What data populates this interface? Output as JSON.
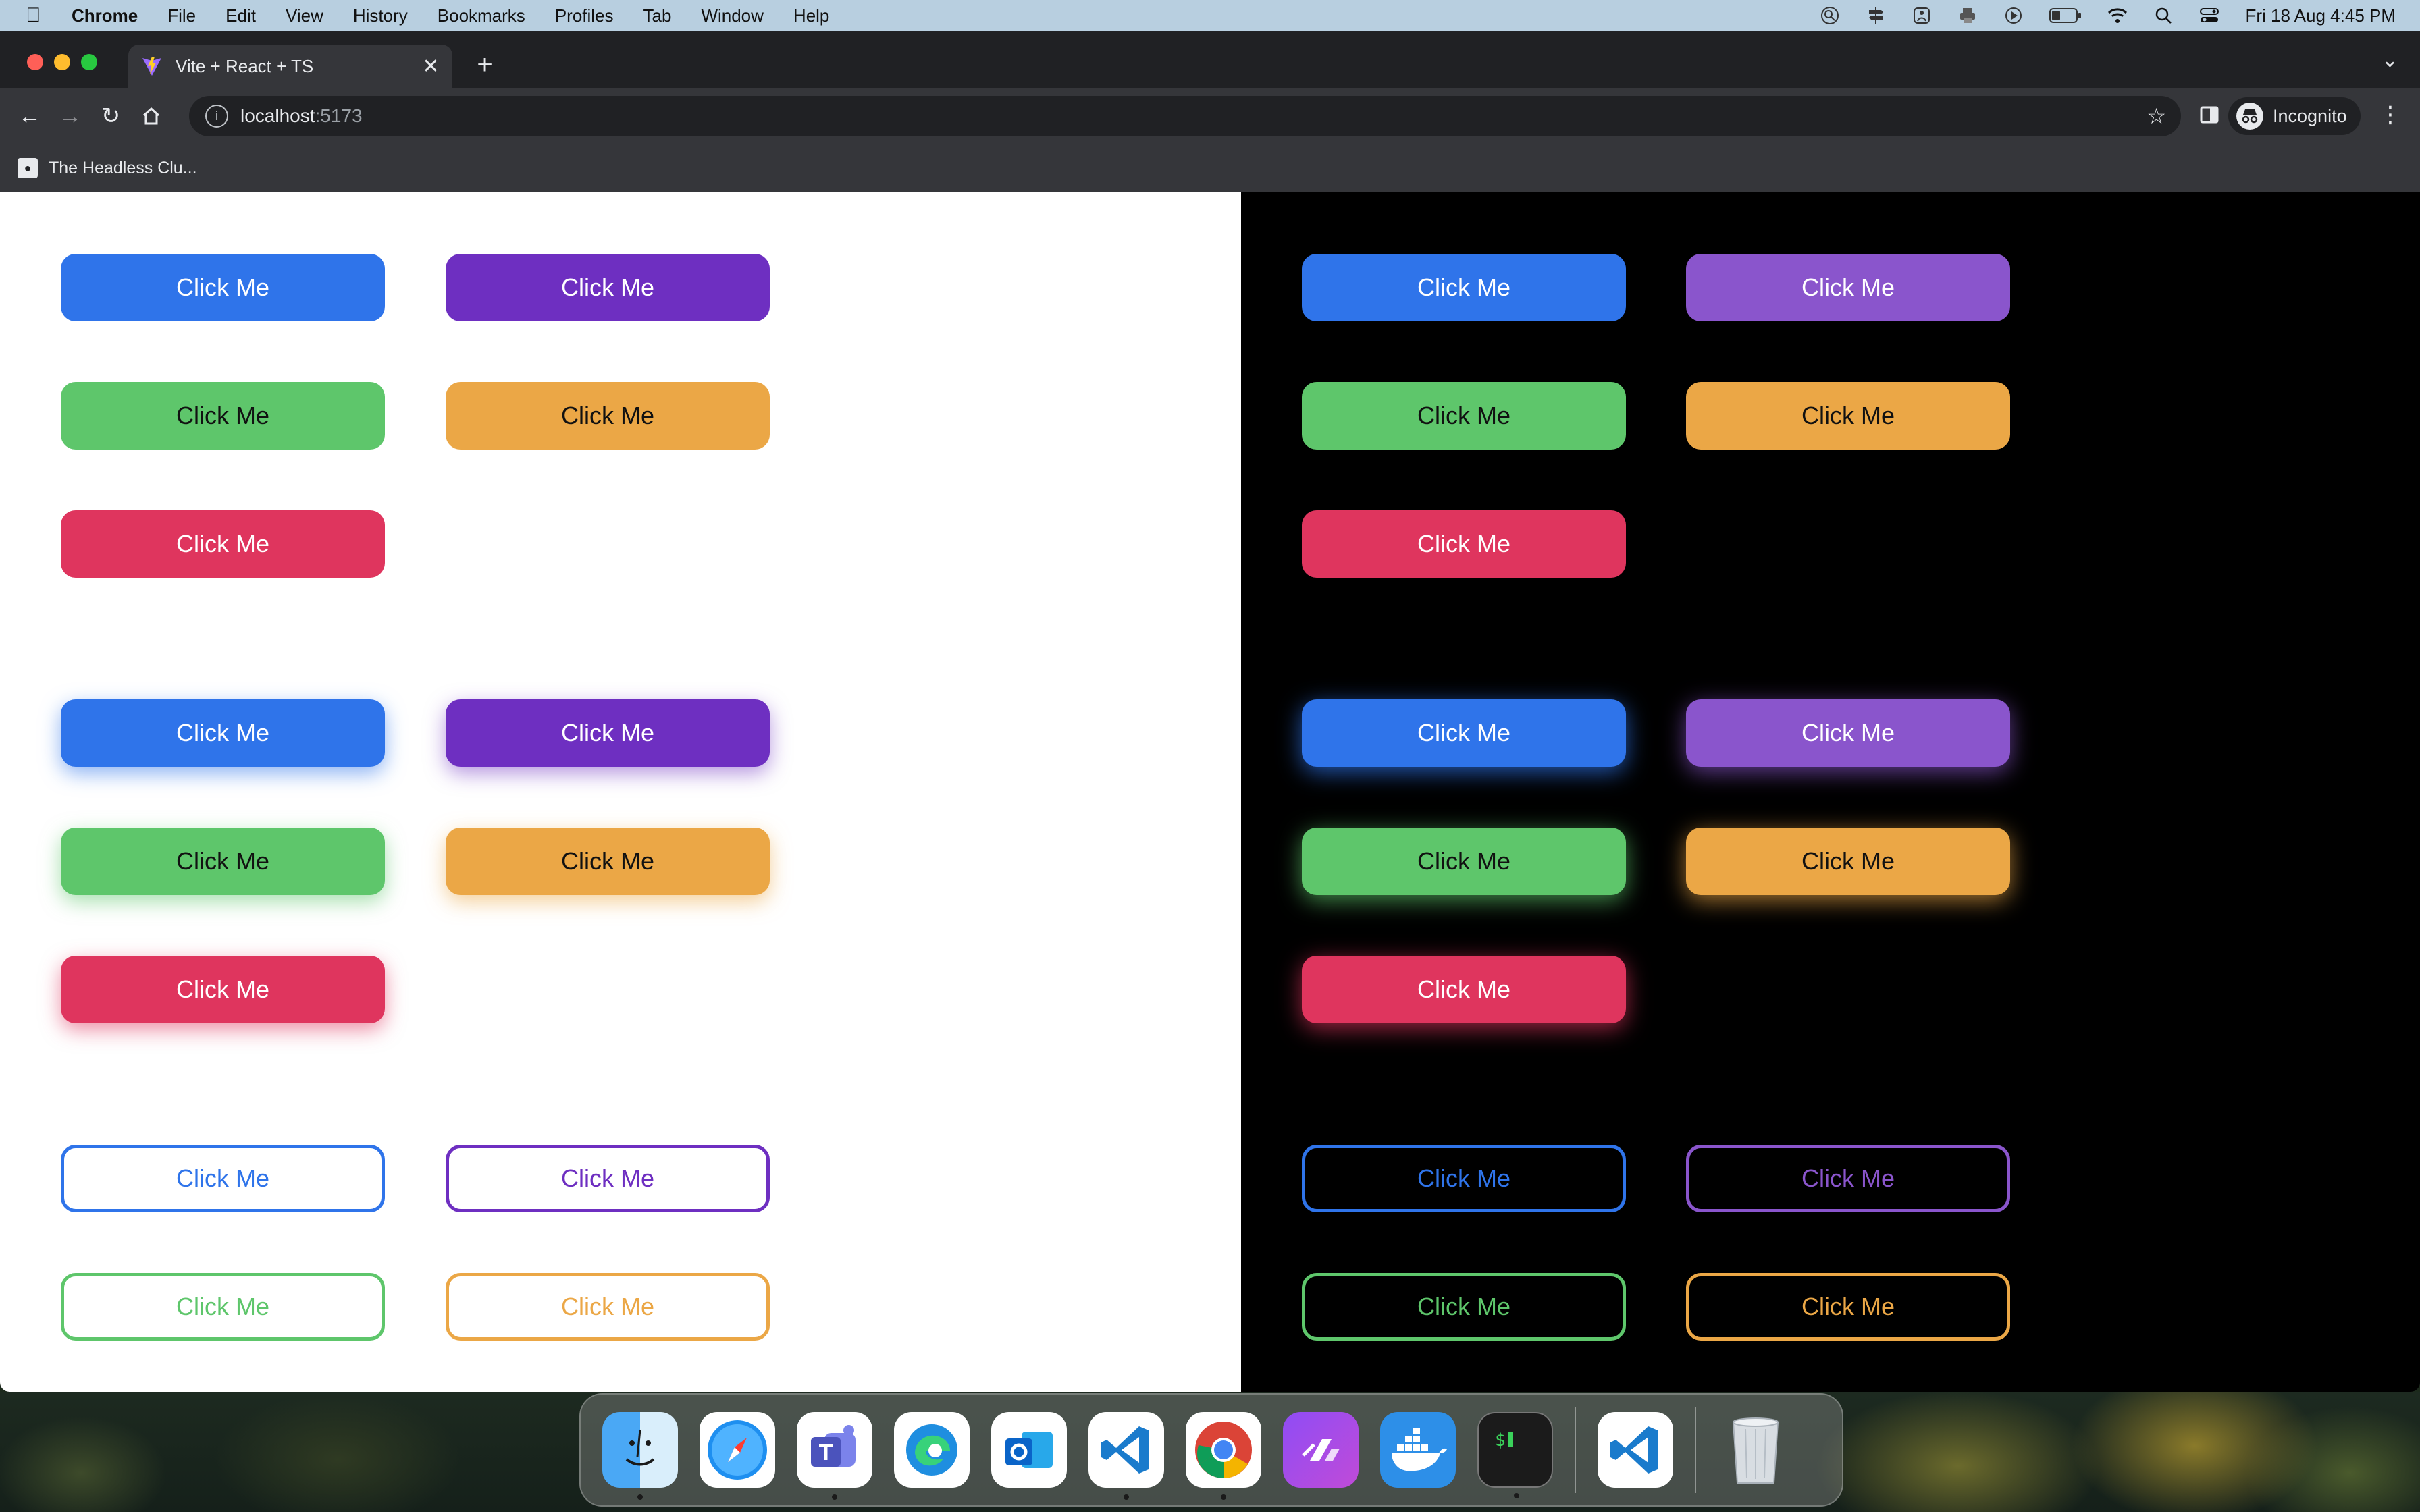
{
  "menubar": {
    "app_name": "Chrome",
    "items": [
      "File",
      "Edit",
      "View",
      "History",
      "Bookmarks",
      "Profiles",
      "Tab",
      "Window",
      "Help"
    ],
    "datetime": "Fri 18 Aug  4:45 PM"
  },
  "browser": {
    "tab_title": "Vite + React + TS",
    "url_host": "localhost",
    "url_port": ":5173",
    "profile_label": "Incognito",
    "bookmark_label": "The Headless Clu..."
  },
  "page": {
    "button_label": "Click Me",
    "colors": {
      "blue": "#2f74ea",
      "purple_light_bg": "#6e2fc1",
      "purple_dark_bg": "#8a55cc",
      "green": "#5ec66b",
      "orange": "#eba746",
      "red": "#df355e"
    }
  },
  "dock": {
    "apps": [
      "Finder",
      "Safari",
      "Microsoft Teams",
      "Microsoft Edge",
      "Microsoft Outlook",
      "Visual Studio Code",
      "Google Chrome",
      "Postman",
      "Docker",
      "Terminal",
      "Visual Studio Code",
      "Trash"
    ]
  }
}
